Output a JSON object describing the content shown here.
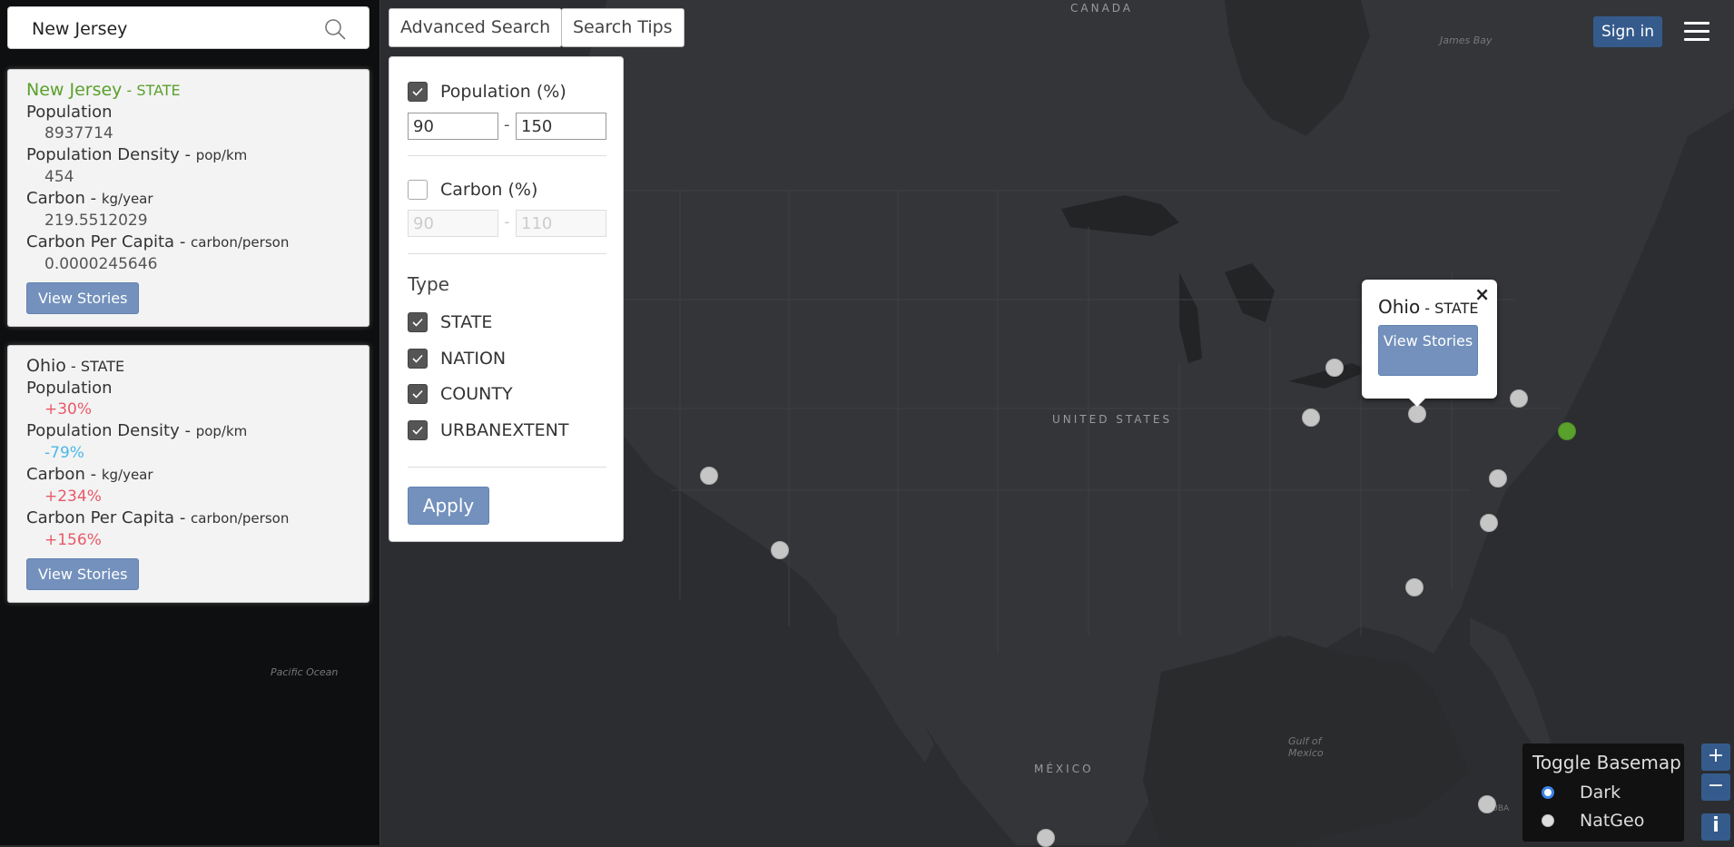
{
  "search": {
    "value": "New Jersey"
  },
  "cards": [
    {
      "title": "New Jersey",
      "type_sep": " - ",
      "type": "STATE",
      "rows": [
        {
          "label": "Population",
          "unit_sep": "",
          "unit": "",
          "value": "8937714"
        },
        {
          "label": "Population Density",
          "unit_sep": " - ",
          "unit": "pop/km",
          "value": "454"
        },
        {
          "label": "Carbon",
          "unit_sep": " - ",
          "unit": "kg/year",
          "value": "219.5512029"
        },
        {
          "label": "Carbon Per Capita",
          "unit_sep": " - ",
          "unit": "carbon/person",
          "value": "0.0000245646"
        }
      ],
      "button": "View Stories"
    },
    {
      "title": "Ohio",
      "type_sep": " - ",
      "type": "STATE",
      "rows": [
        {
          "label": "Population",
          "unit_sep": "",
          "unit": "",
          "value": "+30%"
        },
        {
          "label": "Population Density",
          "unit_sep": " - ",
          "unit": "pop/km",
          "value": "-79%"
        },
        {
          "label": "Carbon",
          "unit_sep": " - ",
          "unit": "kg/year",
          "value": "+234%"
        },
        {
          "label": "Carbon Per Capita",
          "unit_sep": " - ",
          "unit": "carbon/person",
          "value": "+156%"
        }
      ],
      "button": "View Stories"
    }
  ],
  "toolbar": {
    "advanced": "Advanced Search",
    "tips": "Search Tips"
  },
  "advanced_search": {
    "population": {
      "label": "Population (%)",
      "checked": true,
      "min": "90",
      "max": "150",
      "dash": "-"
    },
    "carbon": {
      "label": "Carbon (%)",
      "checked": false,
      "min": "90",
      "max": "110",
      "dash": "-"
    },
    "type_heading": "Type",
    "types": [
      {
        "label": "STATE",
        "checked": true
      },
      {
        "label": "NATION",
        "checked": true
      },
      {
        "label": "COUNTY",
        "checked": true
      },
      {
        "label": "URBANEXTENT",
        "checked": true
      }
    ],
    "apply": "Apply"
  },
  "header": {
    "signin": "Sign in"
  },
  "popup": {
    "title": "Ohio",
    "type_sep": " - ",
    "type": "STATE",
    "button": "View Stories",
    "close": "×"
  },
  "map_labels": {
    "canada": "CANADA",
    "us": "UNITED STATES",
    "mexico": "MÉXICO",
    "james_bay": "James Bay",
    "pacific": "Pacific Ocean",
    "gulf": "Gulf of Mexico",
    "cuba": "CUBA"
  },
  "basemap": {
    "title": "Toggle Basemap",
    "options": [
      {
        "label": "Dark",
        "selected": true
      },
      {
        "label": "NatGeo",
        "selected": false
      }
    ]
  },
  "zoom": {
    "in": "+",
    "out": "−",
    "info": "i"
  },
  "colors": {
    "accent": "#7391bc",
    "highlight": "#5aa02c",
    "increase": "#e85a68",
    "decrease": "#49b9e6",
    "signin": "#355b8c"
  }
}
